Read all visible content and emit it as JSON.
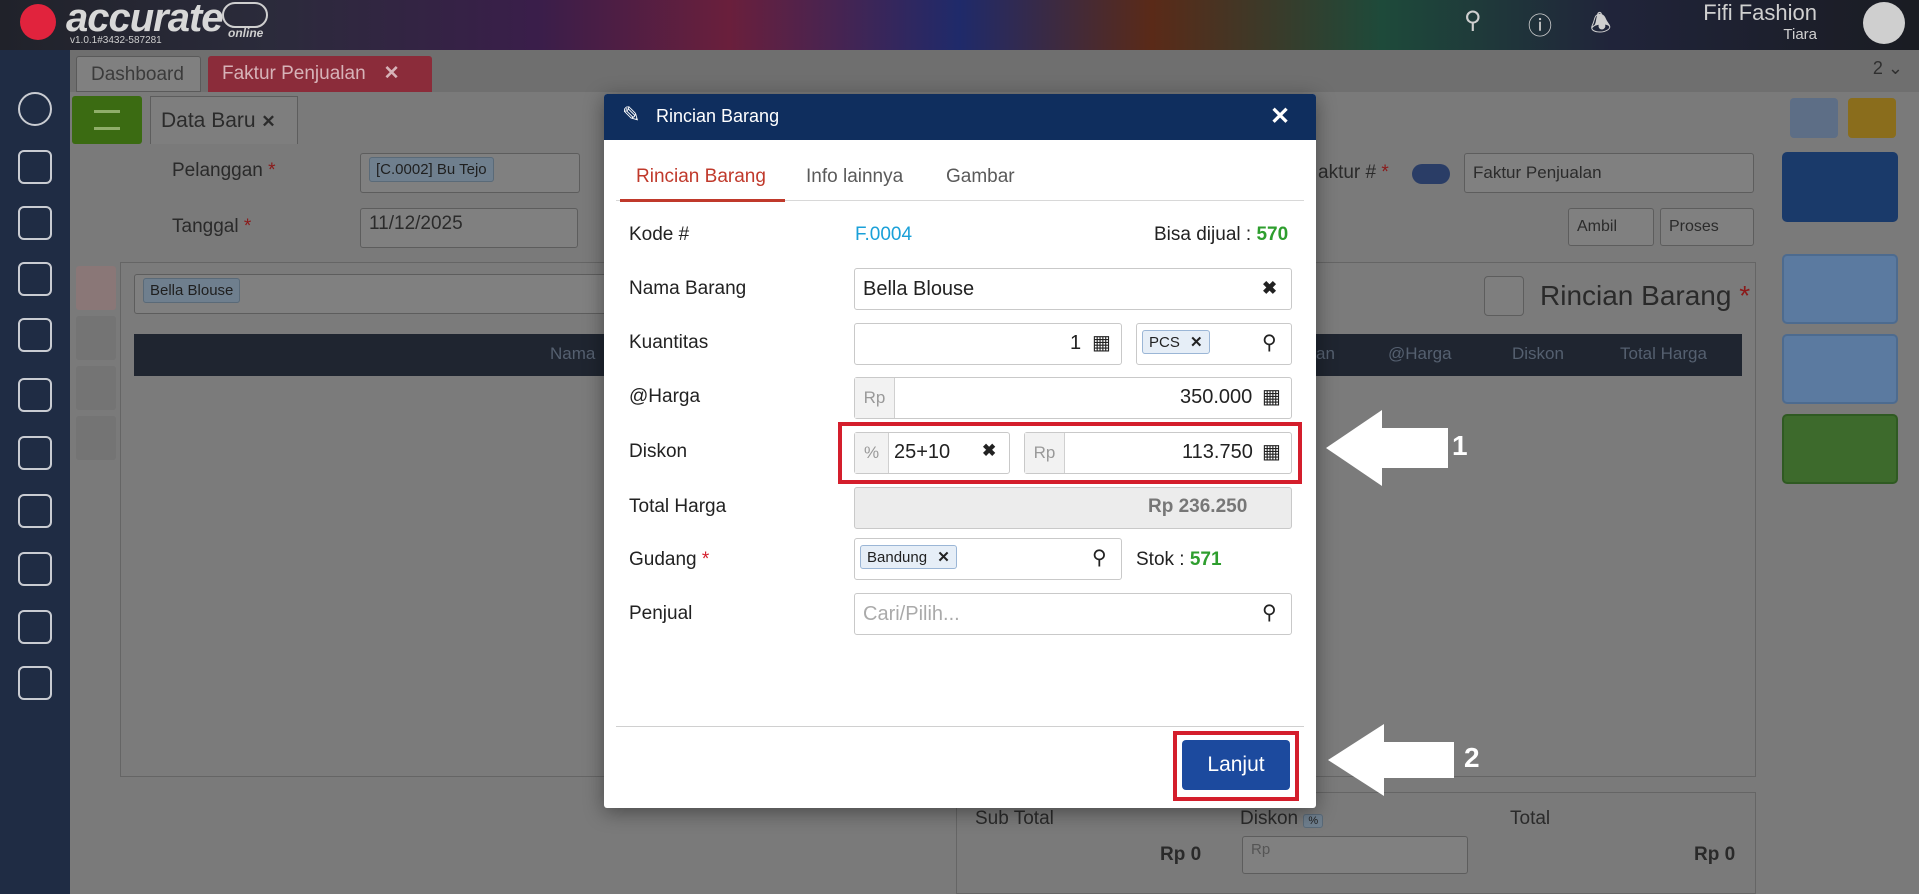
{
  "app": {
    "logo_text": "accurate",
    "logo_sub": "online",
    "version": "v1.0.1#3432-587281",
    "user_name": "Fifi Fashion",
    "user_role": "Tiara"
  },
  "tabs": {
    "dashboard": "Dashboard",
    "faktur": "Faktur Penjualan",
    "count": "2"
  },
  "form": {
    "subtab": "Data Baru",
    "pelanggan_label": "Pelanggan",
    "pelanggan_value": "[C.0002] Bu Tejo",
    "tanggal_label": "Tanggal",
    "tanggal_value": "11/12/2025",
    "faktur_label": "aktur #",
    "faktur_type": "Faktur Penjualan",
    "ambil": "Ambil",
    "proses": "Proses",
    "search_chip": "Bella Blouse",
    "panel_title": "Rincian Barang",
    "col_nama": "Nama",
    "col_an": "an",
    "col_harga": "@Harga",
    "col_diskon": "Diskon",
    "col_total": "Total Harga",
    "subtotal_label": "Sub Total",
    "subtotal_value": "Rp 0",
    "diskon_label": "Diskon",
    "diskon_pct": "%",
    "diskon_rp": "Rp",
    "total_label": "Total",
    "total_value": "Rp 0"
  },
  "modal": {
    "title": "Rincian Barang",
    "tabs": [
      "Rincian Barang",
      "Info lainnya",
      "Gambar"
    ],
    "kode_label": "Kode #",
    "kode_value": "F.0004",
    "bisa_dijual_label": "Bisa dijual :",
    "bisa_dijual_value": "570",
    "nama_label": "Nama Barang",
    "nama_value": "Bella Blouse",
    "kuantitas_label": "Kuantitas",
    "kuantitas_value": "1",
    "unit_value": "PCS",
    "harga_label": "@Harga",
    "harga_prefix": "Rp",
    "harga_value": "350.000",
    "diskon_label": "Diskon",
    "diskon_pct_prefix": "%",
    "diskon_pct_value": "25+10",
    "diskon_rp_prefix": "Rp",
    "diskon_rp_value": "113.750",
    "total_label": "Total Harga",
    "total_value": "Rp 236.250",
    "gudang_label": "Gudang",
    "gudang_value": "Bandung",
    "stok_label": "Stok :",
    "stok_value": "571",
    "penjual_label": "Penjual",
    "penjual_placeholder": "Cari/Pilih...",
    "lanjut": "Lanjut"
  },
  "annotations": {
    "arrow1": "1",
    "arrow2": "2"
  },
  "colors": {
    "modal_header": "#0f2e5e",
    "accent_red": "#c0392b",
    "kode_blue": "#1aa0d8",
    "stock_green": "#2e9e2e",
    "highlight_red": "#d41e2c",
    "button_blue": "#1c4a9e"
  }
}
